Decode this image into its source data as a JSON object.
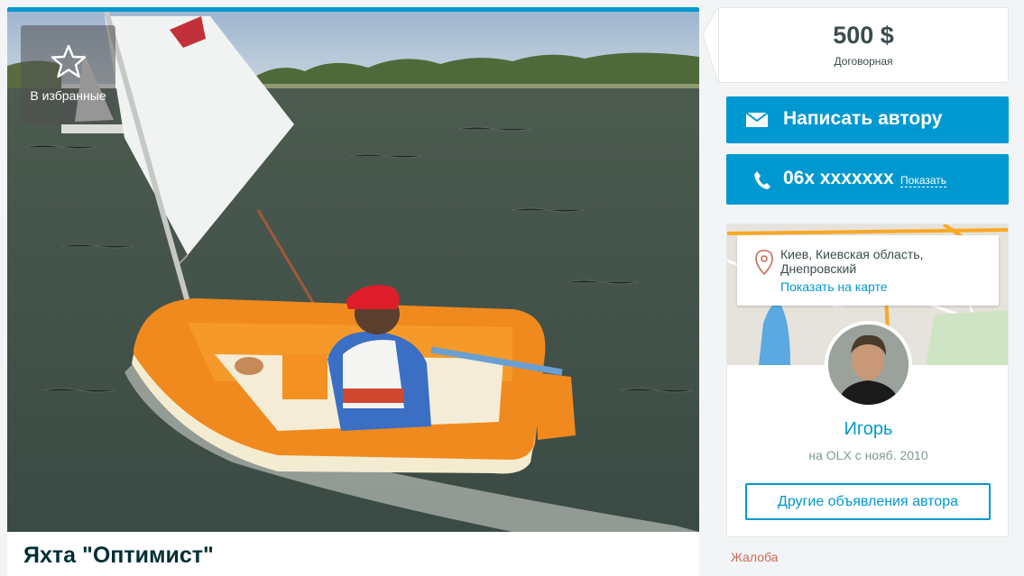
{
  "photo": {
    "favorite_label": "В избранные",
    "icon": "star-icon"
  },
  "ad": {
    "title": "Яхта \"Оптимист\""
  },
  "price": {
    "value": "500 $",
    "note": "Договорная"
  },
  "contact": {
    "write_label": "Написать автору",
    "write_icon": "envelope-icon",
    "phone_masked": "06x xxxxxxx",
    "phone_show_label": "Показать",
    "phone_icon": "phone-icon"
  },
  "seller": {
    "location": "Киев, Киевская область, Днепровский",
    "show_on_map": "Показать на карте",
    "name": "Игорь",
    "since": "на OLX с нояб. 2010",
    "other_ads_label": "Другие объявления автора"
  },
  "complain_label": "Жалоба",
  "colors": {
    "accent": "#0098d0",
    "complain": "#c96b56",
    "price_text": "#3b4c4f"
  }
}
